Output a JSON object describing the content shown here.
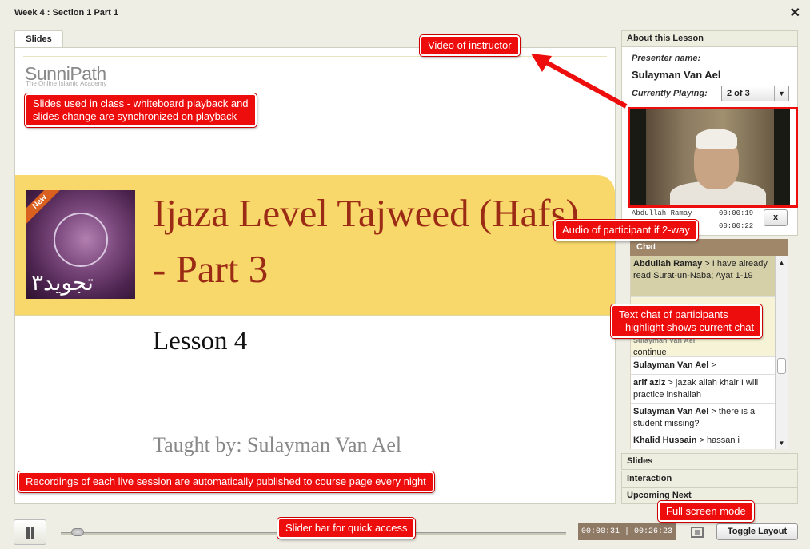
{
  "window": {
    "title": "Week 4 : Section 1 Part 1",
    "close_icon": "close-icon"
  },
  "slides_tab": {
    "label": "Slides"
  },
  "slide": {
    "logo_main": "SunniPath",
    "logo_sub": "The Online Islamic Academy",
    "badge": "New",
    "book_arabic": "تجويد٣",
    "title": "Ijaza Level Tajweed (Hafs) - Part 3",
    "lesson": "Lesson 4",
    "taught_by": "Taught by: Sulayman Van Ael"
  },
  "about": {
    "header": "About this Lesson",
    "presenter_label": "Presenter name:",
    "presenter_name": "Sulayman Van Ael",
    "playing_label": "Currently Playing:",
    "playing_value": "2 of 3",
    "participants": [
      {
        "name": "Abdullah Ramay",
        "time": "00:00:19"
      },
      {
        "name": "",
        "time": "00:00:22"
      }
    ],
    "disconnect_label": "x"
  },
  "chat": {
    "header": "Chat",
    "messages": [
      {
        "user": "Abdullah Ramay",
        "text": "> I have already read Surat-un-Naba; Ayat 1-19",
        "highlight": true
      },
      {
        "user": "Sulayman Van Ael",
        "text": "continue",
        "highlight": true
      },
      {
        "user": "Sulayman Van Ael",
        "text": ">",
        "highlight": false
      },
      {
        "user": "arif aziz",
        "text": "> jazak allah khair I will practice inshallah",
        "highlight": false
      },
      {
        "user": "Sulayman Van Ael",
        "text": "> there is a student missing?",
        "highlight": false
      },
      {
        "user": "Khalid Hussain",
        "text": "> hassan i",
        "highlight": false
      }
    ]
  },
  "sections": {
    "slides": "Slides",
    "interaction": "Interaction",
    "upcoming": "Upcoming Next"
  },
  "controls": {
    "time": "00:00:31 | 00:26:23",
    "progress": 0.02,
    "toggle_layout": "Toggle Layout"
  },
  "annotations": {
    "video": "Video of instructor",
    "slides_1": "Slides used in class - whiteboard playback and",
    "slides_2": "slides change are synchronized on playback",
    "audio": "Audio of participant if 2-way",
    "chat_1": "Text chat of participants",
    "chat_2": "- highlight shows current chat",
    "recordings": "Recordings of each live session are automatically published to course page every night",
    "fullscreen": "Full screen mode",
    "slider": "Slider bar for quick access"
  },
  "colors": {
    "annotation_red": "#ee0d0d",
    "banner_yellow": "#f8d86a",
    "title_red": "#9c2b15",
    "chat_brown": "#a0876a"
  }
}
